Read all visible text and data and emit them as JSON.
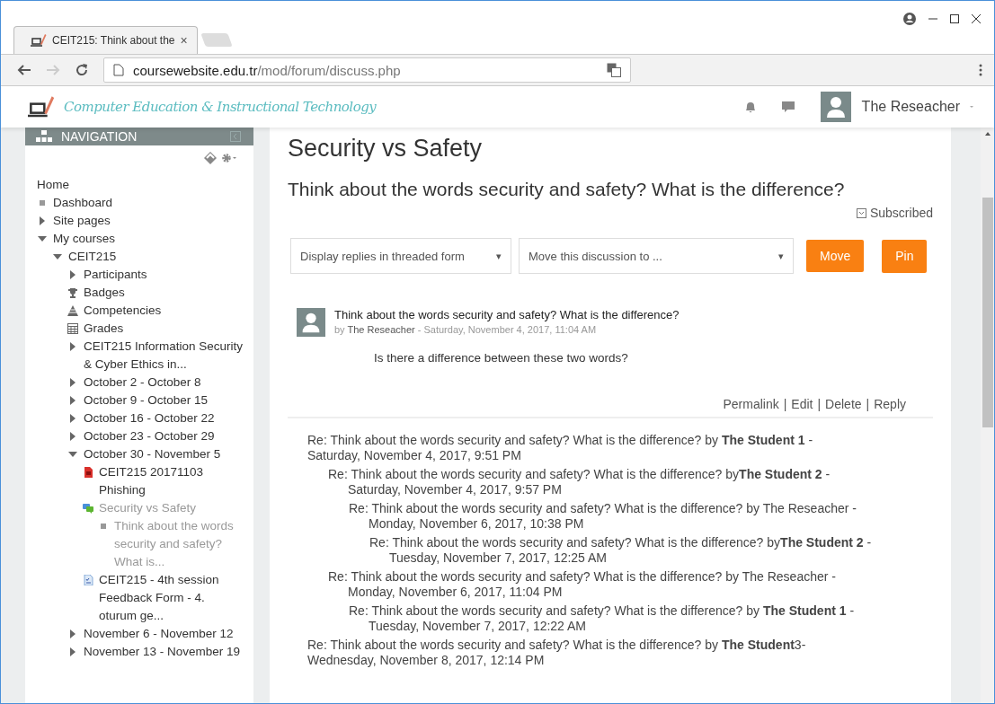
{
  "browser": {
    "tab_title": "CEIT215: Think about the",
    "tab_close": "×",
    "url_host": "coursewebsite.edu.tr",
    "url_path": "/mod/forum/discuss.php"
  },
  "site": {
    "brand": "Computer Education & Instructional Technology",
    "user": "The Reseacher"
  },
  "navigation": {
    "title": "NAVIGATION",
    "items": [
      {
        "label": "Home",
        "selected": false,
        "children": [
          {
            "label": "Dashboard",
            "kind": "bullet",
            "selected": false
          },
          {
            "label": "Site pages",
            "kind": "branch",
            "expanded": false,
            "selected": false
          },
          {
            "label": "My courses",
            "kind": "branch",
            "expanded": true,
            "selected": false,
            "children": [
              {
                "label": "CEIT215",
                "kind": "branch",
                "expanded": true,
                "selected": false,
                "children": [
                  {
                    "label": "Participants",
                    "kind": "branch",
                    "expanded": false,
                    "selected": false
                  },
                  {
                    "label": "Badges",
                    "kind": "trophy",
                    "selected": false
                  },
                  {
                    "label": "Competencies",
                    "kind": "competency",
                    "selected": false
                  },
                  {
                    "label": "Grades",
                    "kind": "grades",
                    "selected": false
                  },
                  {
                    "label": "CEIT215 Information Security & Cyber Ethics in...",
                    "kind": "branch",
                    "expanded": false,
                    "selected": false
                  },
                  {
                    "label": "October 2 - October 8",
                    "kind": "branch",
                    "expanded": false,
                    "selected": false
                  },
                  {
                    "label": "October 9 - October 15",
                    "kind": "branch",
                    "expanded": false,
                    "selected": false
                  },
                  {
                    "label": "October 16 - October 22",
                    "kind": "branch",
                    "expanded": false,
                    "selected": false
                  },
                  {
                    "label": "October 23 - October 29",
                    "kind": "branch",
                    "expanded": false,
                    "selected": false
                  },
                  {
                    "label": "October 30 - November 5",
                    "kind": "branch",
                    "expanded": true,
                    "selected": false,
                    "children": [
                      {
                        "label": "CEIT215 20171103 Phishing",
                        "kind": "pdf",
                        "selected": false
                      },
                      {
                        "label": "Security vs Safety",
                        "kind": "forum",
                        "selected": true,
                        "children": [
                          {
                            "label": "Think about the words security and safety? What is...",
                            "kind": "bullet",
                            "selected": true
                          }
                        ]
                      },
                      {
                        "label": "CEIT215 - 4th session Feedback Form - 4. oturum ge...",
                        "kind": "feedback",
                        "selected": false
                      }
                    ]
                  },
                  {
                    "label": "November 6 - November 12",
                    "kind": "branch",
                    "expanded": false,
                    "selected": false
                  },
                  {
                    "label": "November 13 - November 19",
                    "kind": "branch",
                    "expanded": false,
                    "selected": false
                  }
                ]
              }
            ]
          }
        ]
      }
    ]
  },
  "forum": {
    "title": "Security vs Safety",
    "discussion": "Think about the words security and safety? What is the difference?",
    "subscription": "Subscribed",
    "display_select": "Display replies in threaded form",
    "move_select": "Move this discussion to ...",
    "caret": "▾",
    "buttons": [
      "Move",
      "Pin"
    ]
  },
  "post": {
    "subject": "Think about the words security and safety? What is the difference?",
    "by_label": "by",
    "author": "The Reseacher",
    "date": "- Saturday, November 4, 2017, 11:04 AM",
    "body": "Is there a difference between these two words?",
    "separator": "|",
    "commands": [
      "Permalink",
      "Edit",
      "Delete",
      "Reply"
    ]
  },
  "replies": [
    {
      "title": "Re: Think about the words security and safety? What is the difference? by **The Student 1** -",
      "date": "Saturday, November 4, 2017, 9:51 PM",
      "children": [
        {
          "title": "Re: Think about the words security and safety? What is the difference? by**The Student 2** -",
          "date": "Saturday, November 4, 2017, 9:57 PM",
          "children": [
            {
              "title": "Re: Think about the words security and safety? What is the difference? by The Reseacher -",
              "date": "Monday, November 6, 2017, 10:38 PM",
              "children": [
                {
                  "title": "Re: Think about the words security and safety? What is the difference? by**The Student 2** -",
                  "date": "Tuesday, November 7, 2017, 12:25 AM"
                }
              ]
            }
          ]
        },
        {
          "title": "Re: Think about the words security and safety? What is the difference? by The Reseacher -",
          "date": "Monday, November 6, 2017, 11:04 PM",
          "children": [
            {
              "title": "Re: Think about the words security and safety? What is the difference? by **The Student 1** -",
              "date": "Tuesday, November 7, 2017, 12:22 AM"
            }
          ]
        }
      ]
    },
    {
      "title": "Re: Think about the words security and safety? What is the difference? by **The Student**3-",
      "date": "Wednesday, November 8, 2017, 12:14 PM"
    }
  ]
}
